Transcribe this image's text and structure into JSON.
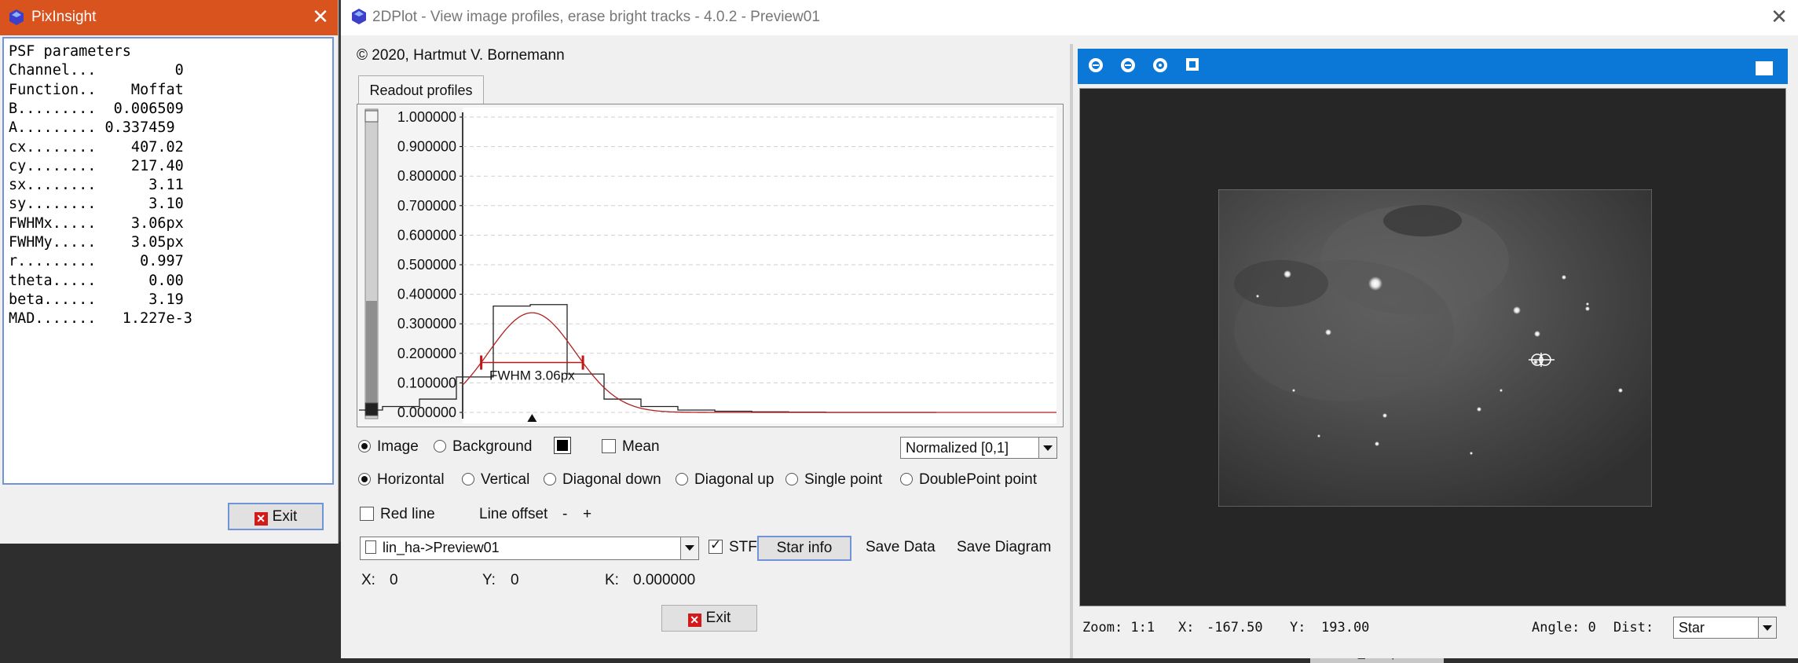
{
  "pixinsight_window": {
    "title": "PixInsight",
    "psf_rows": [
      "PSF parameters",
      "Channel...         0",
      "Function..    Moffat",
      "B.........  0.006509",
      "A......... 0.337459",
      "cx........    407.02",
      "cy........    217.40",
      "sx........      3.11",
      "sy........      3.10",
      "FWHMx.....    3.06px",
      "FWHMy.....    3.05px",
      "r.........     0.997",
      "theta.....      0.00",
      "beta......      3.19",
      "MAD.......   1.227e-3"
    ],
    "exit_label": "Exit"
  },
  "plot_window": {
    "title": "2DPlot - View image profiles, erase bright tracks - 4.0.2 - Preview01",
    "copyright": "© 2020, Hartmut V. Bornemann",
    "tab_label": "Readout profiles",
    "chart_data": {
      "type": "line",
      "y_ticks": [
        "1.000000",
        "0.900000",
        "0.800000",
        "0.700000",
        "0.600000",
        "0.500000",
        "0.400000",
        "0.300000",
        "0.200000",
        "0.100000",
        "0.000000"
      ],
      "ylim": [
        0,
        1
      ],
      "fwhm_label": "FWHM 3.06px",
      "series": [
        {
          "kind": "step",
          "color": "#222222",
          "values": [
            0.0,
            0.0,
            0.0,
            0.001,
            0.002,
            0.004,
            0.008,
            0.02,
            0.045,
            0.12,
            0.36,
            0.365,
            0.13,
            0.045,
            0.02,
            0.008,
            0.004,
            0.002,
            0.001,
            0.0,
            0.0,
            0.0
          ]
        },
        {
          "kind": "curve",
          "color": "#b02020",
          "peak": 0.3375,
          "center": 10.55,
          "sigma": 1.3
        }
      ]
    },
    "source_options": {
      "image": "Image",
      "background": "Background",
      "mean": "Mean",
      "normalization": "Normalized [0,1]"
    },
    "direction_options": [
      "Horizontal",
      "Vertical",
      "Diagonal down",
      "Diagonal up",
      "Single point",
      "DoublePoint point"
    ],
    "red_line_label": "Red line",
    "line_offset_label": "Line offset",
    "minus": "-",
    "plus": "+",
    "view_select": "lin_ha->Preview01",
    "stf_label": "STF",
    "star_info_label": "Star info",
    "save_data_label": "Save Data",
    "save_diagram_label": "Save Diagram",
    "readout": {
      "x_label": "X:",
      "x_value": "0",
      "y_label": "Y:",
      "y_value": "0",
      "k_label": "K:",
      "k_value": "0.000000"
    },
    "exit_label": "Exit"
  },
  "viewer": {
    "zoom": "Zoom: 1:1",
    "x_label": "X:",
    "x_value": "-167.50",
    "y_label": "Y:",
    "y_value": "193.00",
    "angle": "Angle: 0",
    "dist_label": "Dist:",
    "dist_select": "Star"
  },
  "taskbar": {
    "item_label": "MLT_Sharpen"
  },
  "colors": {
    "pixinsight_title": "#d9531e",
    "viewer_toolbar": "#0b78d7",
    "fwhm_marker": "#c01818"
  }
}
